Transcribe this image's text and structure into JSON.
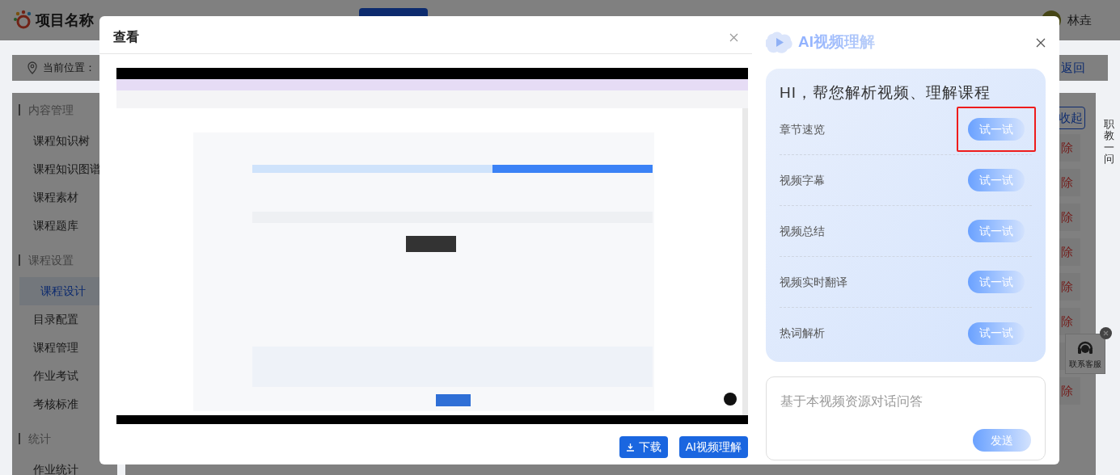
{
  "page": {
    "logo_title": "项目名称",
    "breadcrumb": "当前位置：",
    "back_link": "返回",
    "user_name": "林垚",
    "collapse_button": "收起",
    "sidebar": [
      {
        "heading": "内容管理",
        "items": [
          {
            "label": "课程知识树",
            "selected": false
          },
          {
            "label": "课程知识图谱",
            "selected": false
          },
          {
            "label": "课程素材",
            "selected": false
          },
          {
            "label": "课程题库",
            "selected": false
          }
        ]
      },
      {
        "heading": "课程设置",
        "items": [
          {
            "label": "课程设计",
            "selected": true
          },
          {
            "label": "目录配置",
            "selected": false
          },
          {
            "label": "课程管理",
            "selected": false
          },
          {
            "label": "作业考试",
            "selected": false
          },
          {
            "label": "考核标准",
            "selected": false
          }
        ]
      },
      {
        "heading": "统计",
        "items": [
          {
            "label": "作业统计",
            "selected": false
          }
        ]
      }
    ],
    "row_actions": [
      "除",
      "除",
      "除",
      "除",
      "除",
      "除",
      "除"
    ],
    "side_tab": "职教一问",
    "support_widget": "联系客服"
  },
  "modal": {
    "title": "查看",
    "buttons": [
      {
        "label": "下载",
        "kind": "download"
      },
      {
        "label": "AI视频理解",
        "kind": "plain"
      }
    ]
  },
  "ai_panel": {
    "title": "AI视频理解",
    "greeting": "HI，帮您解析视频、理解课程",
    "features": [
      {
        "label": "章节速览",
        "action": "试一试",
        "highlighted": true
      },
      {
        "label": "视频字幕",
        "action": "试一试",
        "highlighted": false
      },
      {
        "label": "视频总结",
        "action": "试一试",
        "highlighted": false
      },
      {
        "label": "视频实时翻译",
        "action": "试一试",
        "highlighted": false
      },
      {
        "label": "热词解析",
        "action": "试一试",
        "highlighted": false
      }
    ],
    "chat": {
      "placeholder": "基于本视频资源对话问答",
      "send": "发送"
    }
  }
}
